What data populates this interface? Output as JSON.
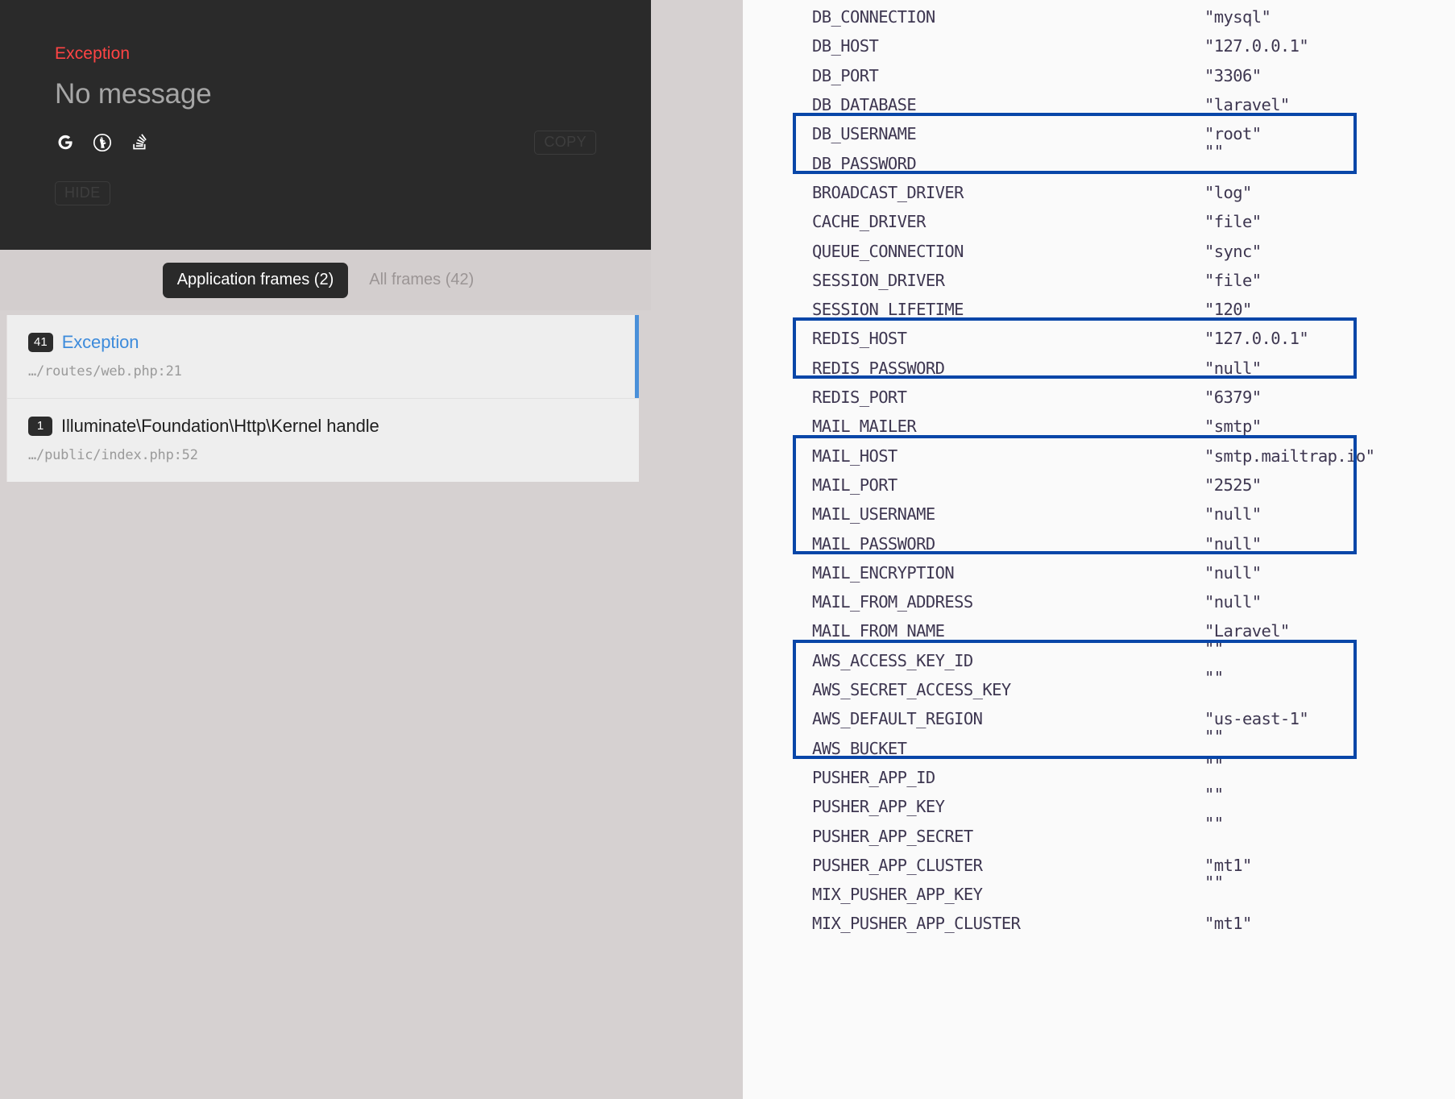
{
  "exception": {
    "class": "Exception",
    "message": "No message",
    "copy_label": "COPY",
    "hide_label": "HIDE",
    "search_icons": [
      {
        "name": "google-search-icon",
        "label": "G"
      },
      {
        "name": "duckduckgo-search-icon",
        "label": "DuckDuckGo"
      },
      {
        "name": "stackoverflow-search-icon",
        "label": "Stack Overflow"
      }
    ]
  },
  "frames_tabs": [
    {
      "label": "Application frames (2)",
      "active": true
    },
    {
      "label": "All frames (42)",
      "active": false
    }
  ],
  "frames": [
    {
      "badge": "41",
      "name": "Exception",
      "path": "…/routes/web.php:21",
      "selected": true,
      "is_link": true
    },
    {
      "badge": "1",
      "name": "Illuminate\\Foundation\\Http\\Kernel handle",
      "path": "…/public/index.php:52",
      "selected": false,
      "is_link": false
    }
  ],
  "env": {
    "highlight_color": "#0846a8",
    "rows": [
      {
        "key": "DB_CONNECTION",
        "value": "\"mysql\""
      },
      {
        "key": "DB_HOST",
        "value": "\"127.0.0.1\""
      },
      {
        "key": "DB_PORT",
        "value": "\"3306\""
      },
      {
        "key": "DB_DATABASE",
        "value": "\"laravel\""
      },
      {
        "key": "DB_USERNAME",
        "value": "\"root\""
      },
      {
        "key": "DB_PASSWORD",
        "value": "\"\""
      },
      {
        "key": "BROADCAST_DRIVER",
        "value": "\"log\""
      },
      {
        "key": "CACHE_DRIVER",
        "value": "\"file\""
      },
      {
        "key": "QUEUE_CONNECTION",
        "value": "\"sync\""
      },
      {
        "key": "SESSION_DRIVER",
        "value": "\"file\""
      },
      {
        "key": "SESSION_LIFETIME",
        "value": "\"120\""
      },
      {
        "key": "REDIS_HOST",
        "value": "\"127.0.0.1\""
      },
      {
        "key": "REDIS_PASSWORD",
        "value": "\"null\""
      },
      {
        "key": "REDIS_PORT",
        "value": "\"6379\""
      },
      {
        "key": "MAIL_MAILER",
        "value": "\"smtp\""
      },
      {
        "key": "MAIL_HOST",
        "value": "\"smtp.mailtrap.io\""
      },
      {
        "key": "MAIL_PORT",
        "value": "\"2525\""
      },
      {
        "key": "MAIL_USERNAME",
        "value": "\"null\""
      },
      {
        "key": "MAIL_PASSWORD",
        "value": "\"null\""
      },
      {
        "key": "MAIL_ENCRYPTION",
        "value": "\"null\""
      },
      {
        "key": "MAIL_FROM_ADDRESS",
        "value": "\"null\""
      },
      {
        "key": "MAIL_FROM_NAME",
        "value": "\"Laravel\""
      },
      {
        "key": "AWS_ACCESS_KEY_ID",
        "value": "\"\""
      },
      {
        "key": "AWS_SECRET_ACCESS_KEY",
        "value": "\"\""
      },
      {
        "key": "AWS_DEFAULT_REGION",
        "value": "\"us-east-1\""
      },
      {
        "key": "AWS_BUCKET",
        "value": "\"\""
      },
      {
        "key": "PUSHER_APP_ID",
        "value": "\"\""
      },
      {
        "key": "PUSHER_APP_KEY",
        "value": "\"\""
      },
      {
        "key": "PUSHER_APP_SECRET",
        "value": "\"\""
      },
      {
        "key": "PUSHER_APP_CLUSTER",
        "value": "\"mt1\""
      },
      {
        "key": "MIX_PUSHER_APP_KEY",
        "value": "\"\""
      },
      {
        "key": "MIX_PUSHER_APP_CLUSTER",
        "value": "\"mt1\""
      }
    ],
    "highlight_groups": [
      {
        "label": "database-credentials-highlight",
        "start": 4,
        "end": 5
      },
      {
        "label": "redis-credentials-highlight",
        "start": 11,
        "end": 12
      },
      {
        "label": "mail-credentials-highlight",
        "start": 15,
        "end": 18
      },
      {
        "label": "aws-credentials-highlight",
        "start": 22,
        "end": 25
      }
    ]
  }
}
